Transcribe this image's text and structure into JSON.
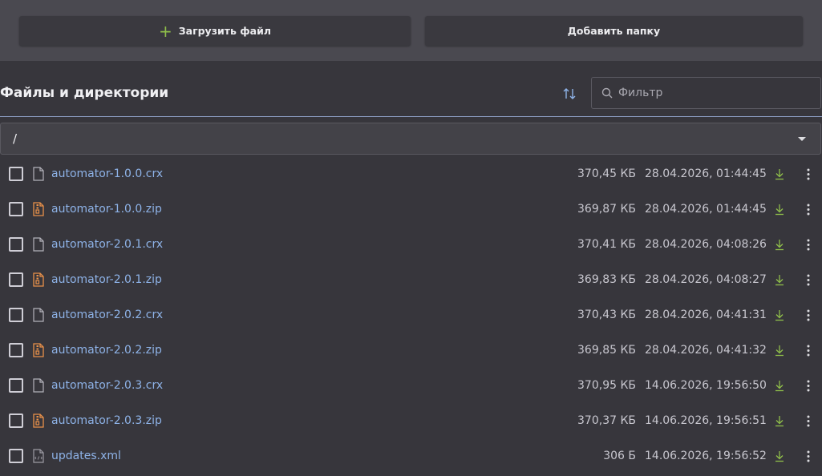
{
  "toolbar": {
    "upload_label": "Загрузить файл",
    "upload_icon": "plus-icon",
    "add_folder_label": "Добавить папку",
    "accent_color": "#8fbe4a"
  },
  "section": {
    "title": "Файлы и директории",
    "sort_icon": "sort-arrows-icon",
    "filter_placeholder": "Фильтр"
  },
  "path": {
    "current": "/"
  },
  "colors": {
    "link": "#8eb3e8",
    "zip_icon": "#e8914a",
    "download": "#8fbe4a"
  },
  "files": [
    {
      "name": "automator-1.0.0.crx",
      "type": "file",
      "size": "370,45 КБ",
      "date": "28.04.2026, 01:44:45"
    },
    {
      "name": "automator-1.0.0.zip",
      "type": "zip",
      "size": "369,87 КБ",
      "date": "28.04.2026, 01:44:45"
    },
    {
      "name": "automator-2.0.1.crx",
      "type": "file",
      "size": "370,41 КБ",
      "date": "28.04.2026, 04:08:26"
    },
    {
      "name": "automator-2.0.1.zip",
      "type": "zip",
      "size": "369,83 КБ",
      "date": "28.04.2026, 04:08:27"
    },
    {
      "name": "automator-2.0.2.crx",
      "type": "file",
      "size": "370,43 КБ",
      "date": "28.04.2026, 04:41:31"
    },
    {
      "name": "automator-2.0.2.zip",
      "type": "zip",
      "size": "369,85 КБ",
      "date": "28.04.2026, 04:41:32"
    },
    {
      "name": "automator-2.0.3.crx",
      "type": "file",
      "size": "370,95 КБ",
      "date": "14.06.2026, 19:56:50"
    },
    {
      "name": "automator-2.0.3.zip",
      "type": "zip",
      "size": "370,37 КБ",
      "date": "14.06.2026, 19:56:51"
    },
    {
      "name": "updates.xml",
      "type": "xml",
      "size": "306 Б",
      "date": "14.06.2026, 19:56:52"
    }
  ]
}
